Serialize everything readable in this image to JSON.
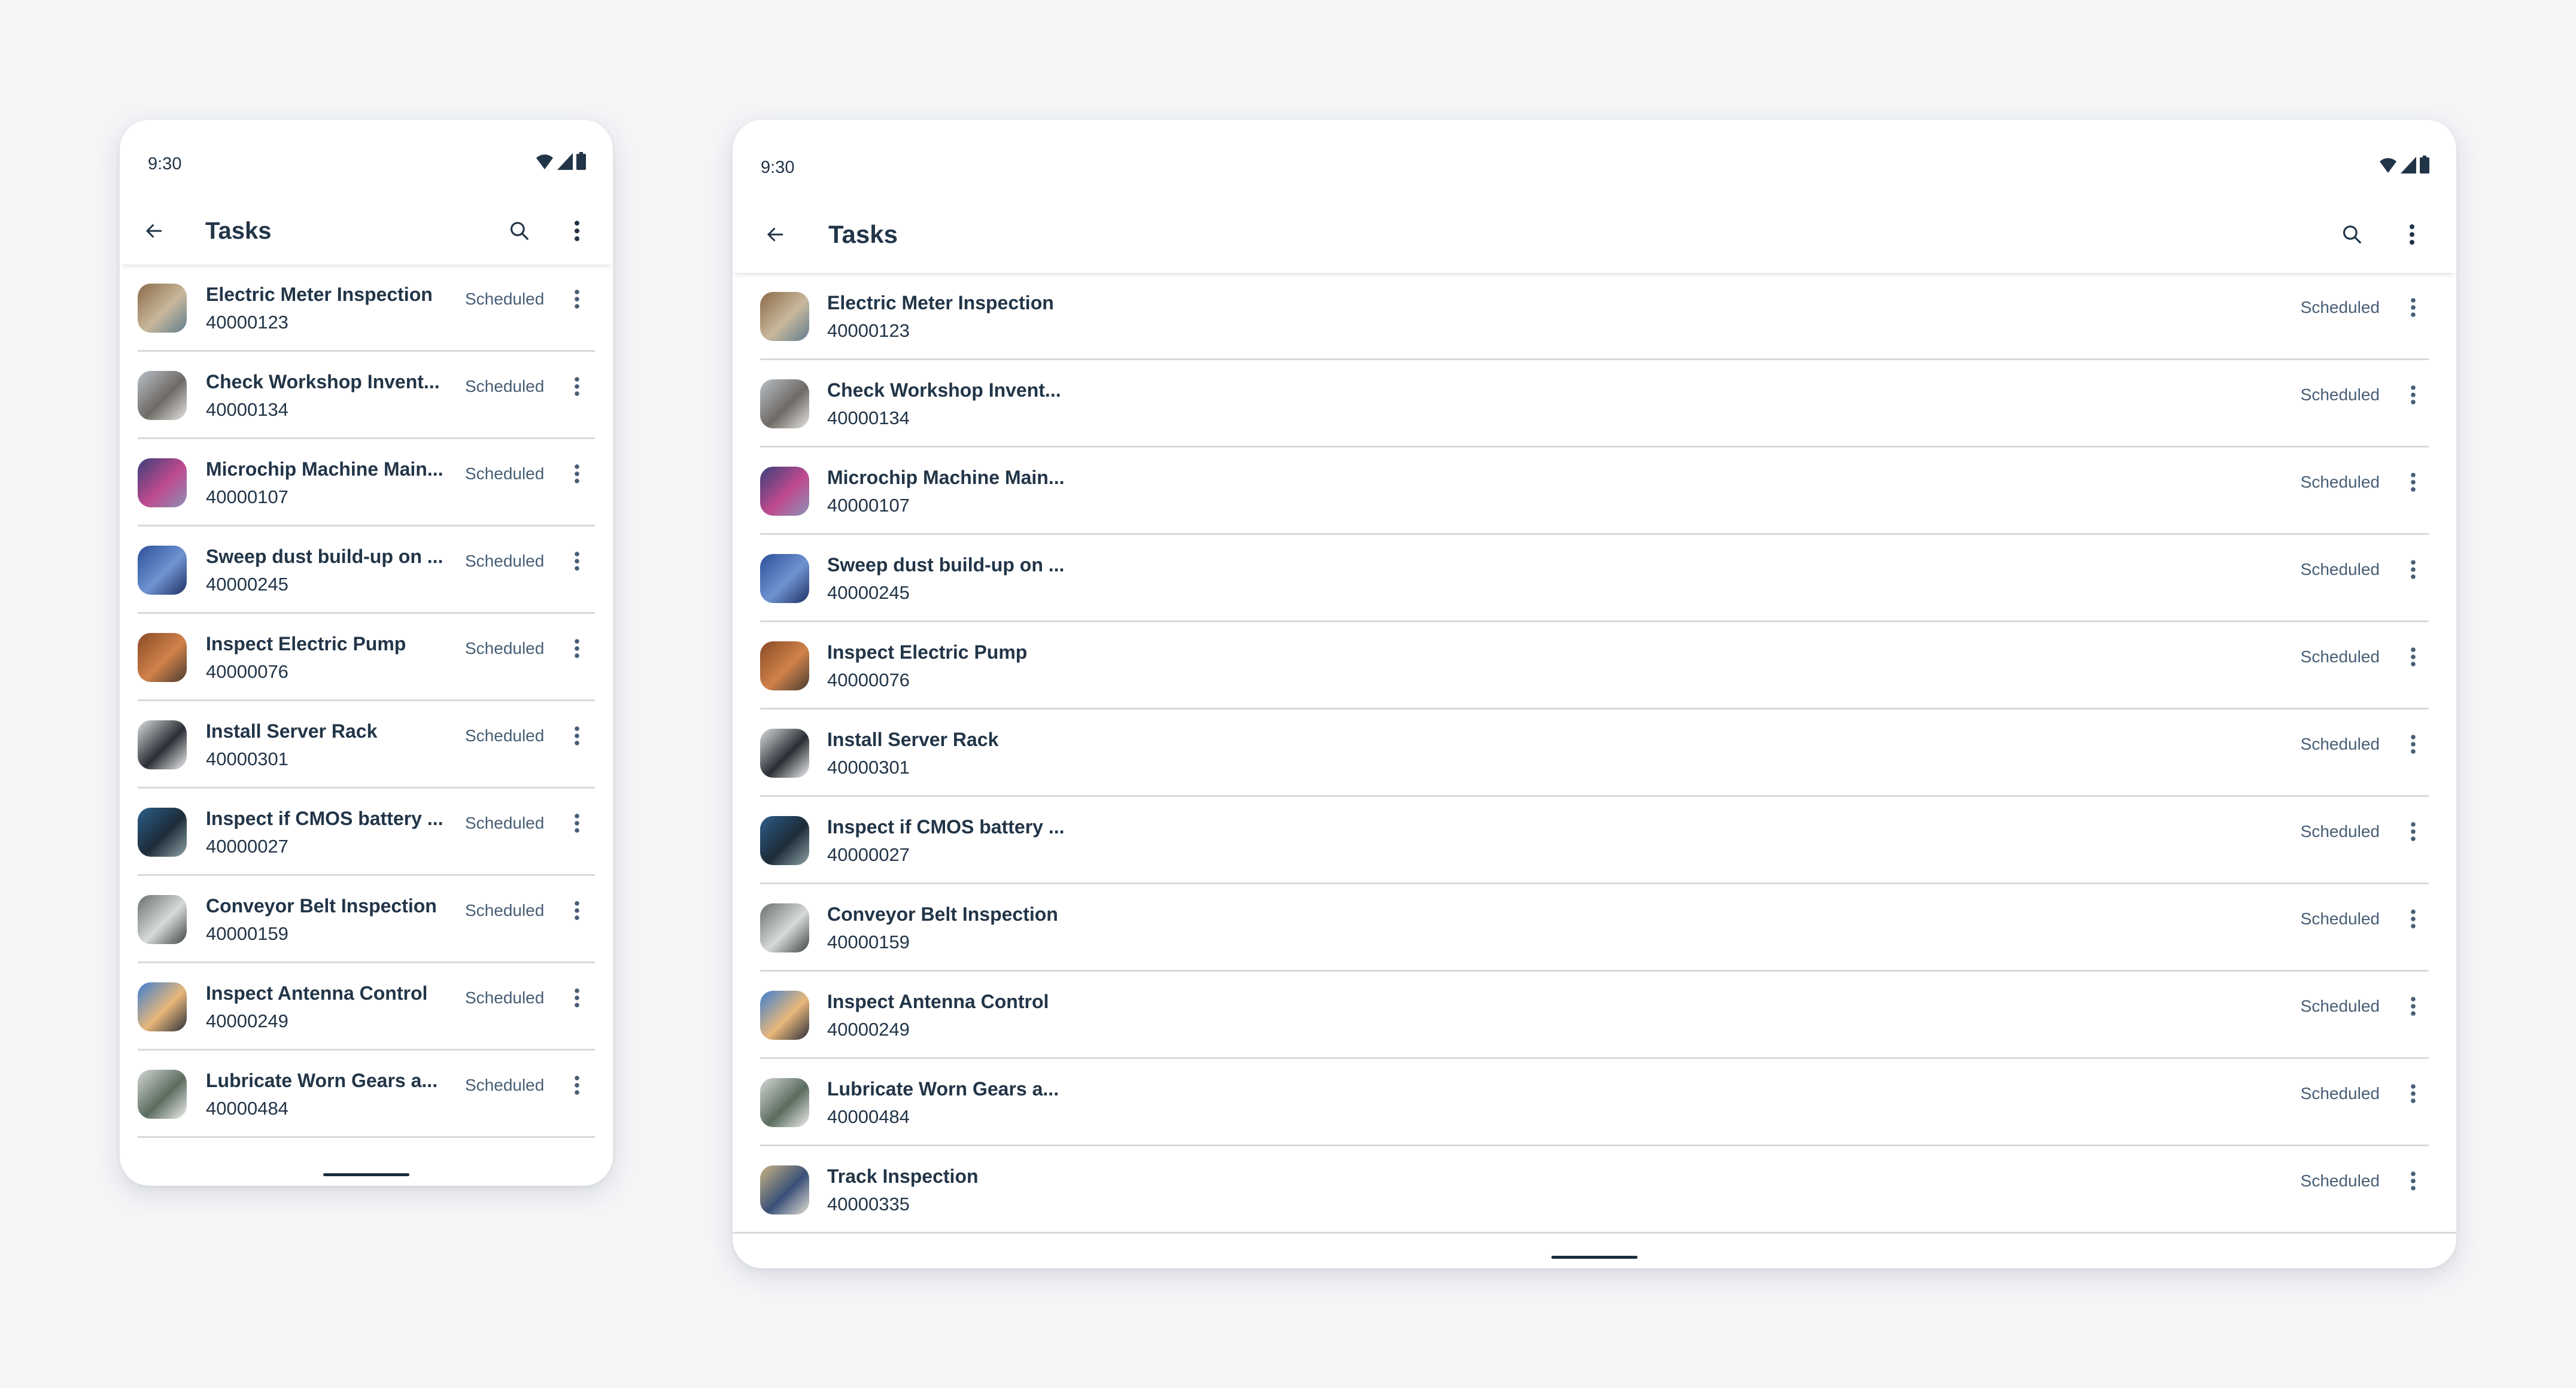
{
  "phone": {
    "status_bar": {
      "time": "9:30",
      "icons": [
        "wifi-icon",
        "signal-icon",
        "battery-icon"
      ]
    },
    "app_bar": {
      "title": "Tasks",
      "back_icon": "arrow-left-icon",
      "actions": [
        "search-icon",
        "more-vertical-icon"
      ]
    }
  },
  "tablet": {
    "status_bar": {
      "time": "9:30",
      "icons": [
        "wifi-icon",
        "signal-icon",
        "battery-icon"
      ]
    },
    "app_bar": {
      "title": "Tasks",
      "back_icon": "arrow-left-icon",
      "actions": [
        "search-icon",
        "more-vertical-icon"
      ]
    }
  },
  "colors": {
    "text_primary": "#223548",
    "text_secondary": "#475e75",
    "separator": "#d5dadd",
    "background": "#f4f5f7",
    "surface": "#ffffff"
  },
  "tasks": [
    {
      "name_phone": "Electric Meter Inspection",
      "name_tablet": "Electric Meter Inspection",
      "number": "40000123",
      "status": "Scheduled",
      "thumb": [
        "#8a6a48",
        "#c9b89c",
        "#5f7d8e"
      ]
    },
    {
      "name_phone": "Check Workshop Invent...",
      "name_tablet": "Check Workshop Invent...",
      "number": "40000134",
      "status": "Scheduled",
      "thumb": [
        "#b9bfc6",
        "#6e6a66",
        "#e6e4e1"
      ]
    },
    {
      "name_phone": "Microchip Machine Main...",
      "name_tablet": "Microchip Machine Main...",
      "number": "40000107",
      "status": "Scheduled",
      "thumb": [
        "#3b3f7a",
        "#c04a8e",
        "#8a92b8"
      ]
    },
    {
      "name_phone": "Sweep dust build-up on ...",
      "name_tablet": "Sweep dust build-up on ...",
      "number": "40000245",
      "status": "Scheduled",
      "thumb": [
        "#2e4f9a",
        "#6f93d1",
        "#1e2f63"
      ]
    },
    {
      "name_phone": "Inspect Electric Pump",
      "name_tablet": "Inspect Electric Pump",
      "number": "40000076",
      "status": "Scheduled",
      "thumb": [
        "#8a4a26",
        "#d0824a",
        "#4a3a30"
      ]
    },
    {
      "name_phone": "Install Server Rack",
      "name_tablet": "Install Server Rack",
      "number": "40000301",
      "status": "Scheduled",
      "thumb": [
        "#d9dcdf",
        "#2a2e34",
        "#f1f2f3"
      ]
    },
    {
      "name_phone": "Inspect if CMOS battery ...",
      "name_tablet": "Inspect if CMOS battery ...",
      "number": "40000027",
      "status": "Scheduled",
      "thumb": [
        "#2c5f8a",
        "#1d2b38",
        "#8fa3a8"
      ]
    },
    {
      "name_phone": "Conveyor Belt Inspection",
      "name_tablet": "Conveyor Belt Inspection",
      "number": "40000159",
      "status": "Scheduled",
      "thumb": [
        "#6a6f70",
        "#d7dad8",
        "#3e4444"
      ]
    },
    {
      "name_phone": "Inspect Antenna Control",
      "name_tablet": "Inspect Antenna Control",
      "number": "40000249",
      "status": "Scheduled",
      "thumb": [
        "#3d7fd0",
        "#e8b77a",
        "#2c2f3a"
      ]
    },
    {
      "name_phone": "Lubricate Worn Gears a...",
      "name_tablet": "Lubricate Worn Gears a...",
      "number": "40000484",
      "status": "Scheduled",
      "thumb": [
        "#d5d7d6",
        "#5a6c5e",
        "#f0f0ee"
      ]
    },
    {
      "name_phone": "Track Inspection",
      "name_tablet": "Track Inspection",
      "number": "40000335",
      "status": "Scheduled",
      "thumb": [
        "#c8b482",
        "#3a4f78",
        "#e3e0d6"
      ]
    }
  ]
}
